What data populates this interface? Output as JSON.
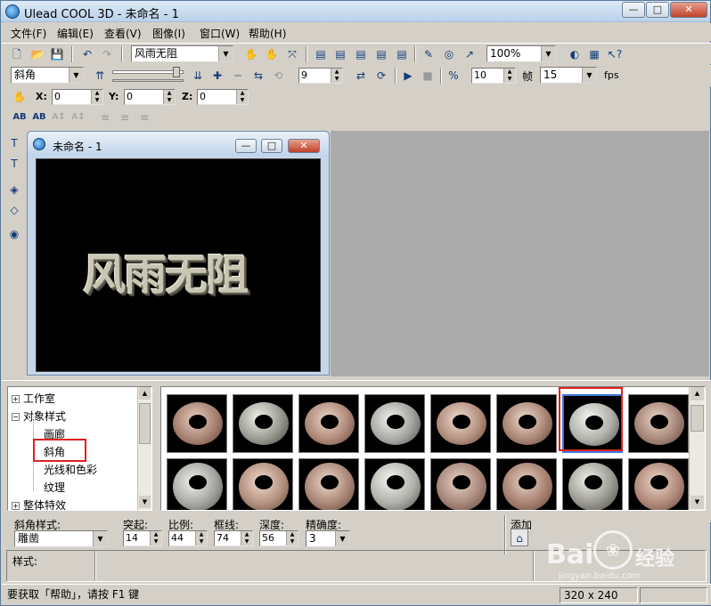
{
  "window": {
    "title": "Ulead COOL 3D - 未命名 - 1",
    "minimize_glyph": "—",
    "maximize_glyph": "□",
    "close_glyph": "✕"
  },
  "menu": [
    "文件(F)",
    "编辑(E)",
    "查看(V)",
    "图像(I)",
    "窗口(W)",
    "帮助(H)"
  ],
  "toolbar1": {
    "text_combo": "风雨无阻",
    "zoom_combo": "100%"
  },
  "toolbar2": {
    "object_combo": "斜角",
    "frame_value": "9",
    "total_frames": "10",
    "frame_label": "帧",
    "fps_value": "15",
    "fps_label": "fps"
  },
  "toolbar3": {
    "x_label": "X:",
    "x_value": "0",
    "y_label": "Y:",
    "y_value": "0",
    "z_label": "Z:",
    "z_value": "0"
  },
  "document": {
    "title": "未命名 - 1",
    "canvas_text": "风雨无阻"
  },
  "tree": {
    "items": [
      "工作室",
      "对象样式",
      "画廊",
      "斜角",
      "光线和色彩",
      "纹理",
      "整体特效"
    ]
  },
  "thumbnails": {
    "selected_index": 6,
    "count_row1": 8,
    "count_row2": 8
  },
  "bevel_settings": {
    "style_label": "斜角样式:",
    "style_value": "雕凿",
    "protrude_label": "突起:",
    "protrude_value": "14",
    "ratio_label": "比例:",
    "ratio_value": "44",
    "border_label": "框线:",
    "border_value": "74",
    "depth_label": "深度:",
    "depth_value": "56",
    "precision_label": "精确度:",
    "precision_value": "3",
    "add_label": "添加",
    "style_row_label": "样式:"
  },
  "status": {
    "help_text": "要获取「帮助」，请按 F1 键",
    "size_text": "320 x 240"
  },
  "watermark": {
    "brand": "Bai",
    "brand_suffix": "经验",
    "url": "jingyan.baidu.com"
  },
  "colors": {
    "highlight_red": "#e02020",
    "selection_blue": "#3a78d8"
  }
}
